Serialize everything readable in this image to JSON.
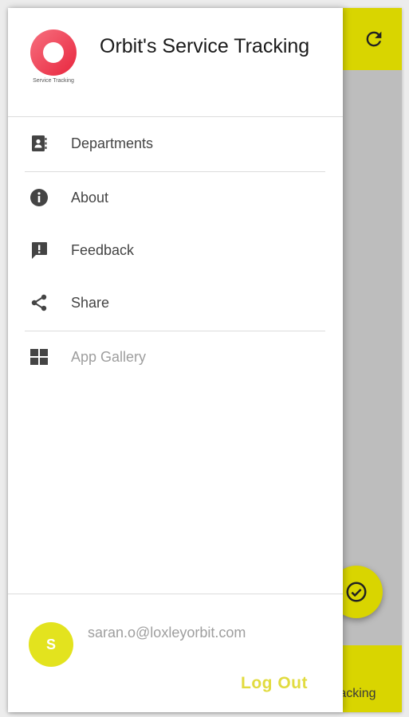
{
  "app": {
    "title": "Orbit's Service Tracking",
    "logo_caption": "Service Tracking"
  },
  "menu": {
    "items": [
      {
        "label": "Departments",
        "icon": "contacts-book-icon"
      },
      {
        "label": "About",
        "icon": "info-icon"
      },
      {
        "label": "Feedback",
        "icon": "feedback-icon"
      },
      {
        "label": "Share",
        "icon": "share-icon"
      },
      {
        "label": "App Gallery",
        "icon": "apps-grid-icon",
        "disabled": true
      }
    ]
  },
  "user": {
    "avatar_initial": "S",
    "email": "saran.o@loxleyorbit.com"
  },
  "footer": {
    "logout_label": "Log Out"
  },
  "background": {
    "bottom_label": "racking"
  },
  "colors": {
    "accent": "#d9d500",
    "avatar": "#e3e31e",
    "logout": "#e1db3f",
    "logo": "#f0445a"
  }
}
